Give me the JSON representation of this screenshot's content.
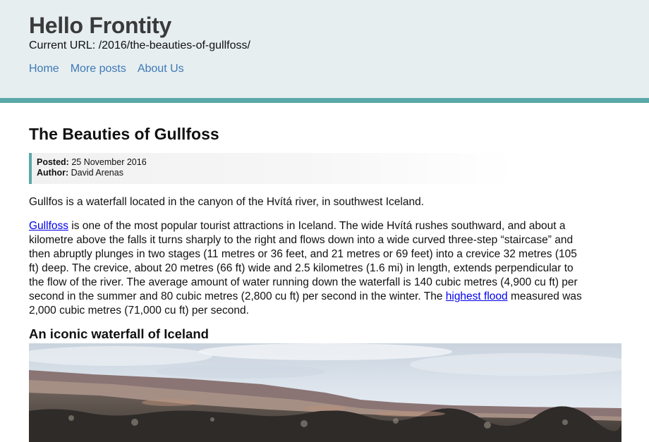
{
  "header": {
    "site_title": "Hello Frontity",
    "current_url_label": "Current URL:",
    "current_url": "/2016/the-beauties-of-gullfoss/",
    "nav": [
      {
        "label": "Home"
      },
      {
        "label": "More posts"
      },
      {
        "label": "About Us"
      }
    ]
  },
  "post": {
    "title": "The Beauties of Gullfoss",
    "meta": {
      "posted_label": "Posted:",
      "posted_value": "25 November 2016",
      "author_label": "Author:",
      "author_value": "David Arenas"
    },
    "intro": "Gullfos is a waterfall located in the canyon of the Hvítá river, in southwest Iceland.",
    "body": {
      "link1": "Gullfoss",
      "text1": " is one of the most popular tourist attractions in Iceland. The wide Hvítá rushes southward, and about a kilometre above the falls it turns sharply to the right and flows down into a wide curved three-step “staircase” and then abruptly plunges in two stages (11 metres or 36 feet, and 21 metres or 69 feet) into a crevice 32 metres (105 ft) deep. The crevice, about 20 metres (66 ft) wide and 2.5 kilometres (1.6 mi) in length, extends perpendicular to the flow of the river. The average amount of water running down the waterfall is 140 cubic metres (4,900 cu ft) per second in the summer and 80 cubic metres (2,800 cu ft) per second in the winter. The ",
      "link2": "highest flood",
      "text2": " measured was 2,000 cubic metres (71,000 cu ft) per second."
    },
    "section_title": "An iconic waterfall of Iceland"
  },
  "colors": {
    "header_bg": "#e6eef0",
    "accent": "#5aa8a8",
    "nav_link": "#3f79b5",
    "body_link": "#0000ee"
  }
}
